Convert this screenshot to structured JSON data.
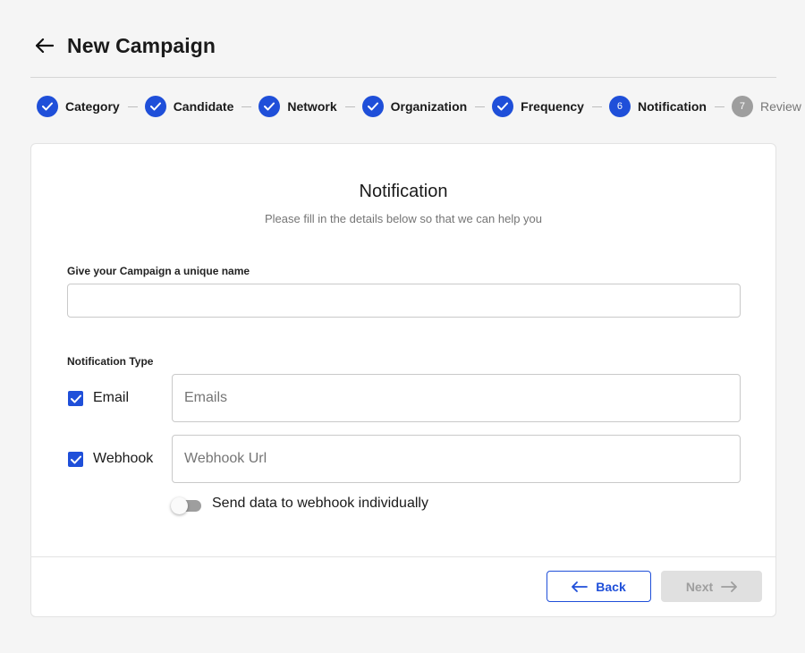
{
  "header": {
    "title": "New Campaign",
    "back_icon": "arrow-left-icon"
  },
  "stepper": {
    "steps": [
      {
        "label": "Category",
        "state": "completed"
      },
      {
        "label": "Candidate",
        "state": "completed"
      },
      {
        "label": "Network",
        "state": "completed"
      },
      {
        "label": "Organization",
        "state": "completed"
      },
      {
        "label": "Frequency",
        "state": "completed"
      },
      {
        "label": "Notification",
        "number": "6",
        "state": "active"
      },
      {
        "label": "Review",
        "number": "7",
        "state": "pending"
      }
    ]
  },
  "form": {
    "title": "Notification",
    "subtitle": "Please fill in the details below so that we can help you",
    "name_label": "Give your Campaign a unique name",
    "name_value": "",
    "type_label": "Notification Type",
    "email": {
      "label": "Email",
      "checked": true,
      "placeholder": "Emails",
      "value": ""
    },
    "webhook": {
      "label": "Webhook",
      "checked": true,
      "placeholder": "Webhook Url",
      "value": ""
    },
    "toggle": {
      "label": "Send data to webhook individually",
      "on": false
    }
  },
  "footer": {
    "back_label": "Back",
    "next_label": "Next"
  },
  "colors": {
    "accent": "#1f4fd9",
    "pending": "#9e9e9e",
    "disabled_bg": "#e0e0e0",
    "page_bg": "#f5f5f5"
  }
}
